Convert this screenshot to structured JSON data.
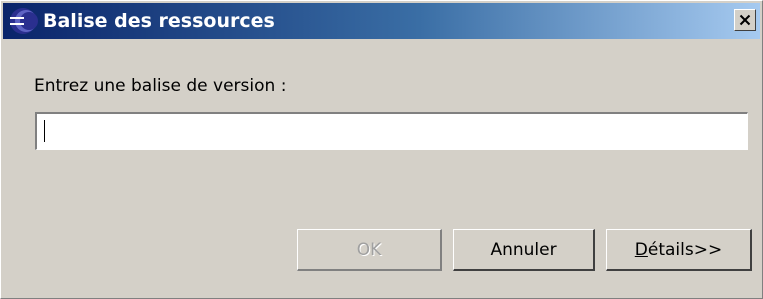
{
  "window": {
    "title": "Balise des ressources",
    "icon": "eclipse-app-icon",
    "close_icon": "close-icon",
    "titlebar_colors": [
      "#0a246a",
      "#a6caf0"
    ]
  },
  "form": {
    "prompt": "Entrez une balise de version :",
    "tag_value": "",
    "tag_placeholder": ""
  },
  "buttons": {
    "ok": {
      "label": "OK",
      "enabled": false
    },
    "cancel": {
      "label": "Annuler",
      "enabled": true
    },
    "details": {
      "mnemonic": "D",
      "label_rest": "étails>>",
      "enabled": true
    }
  }
}
